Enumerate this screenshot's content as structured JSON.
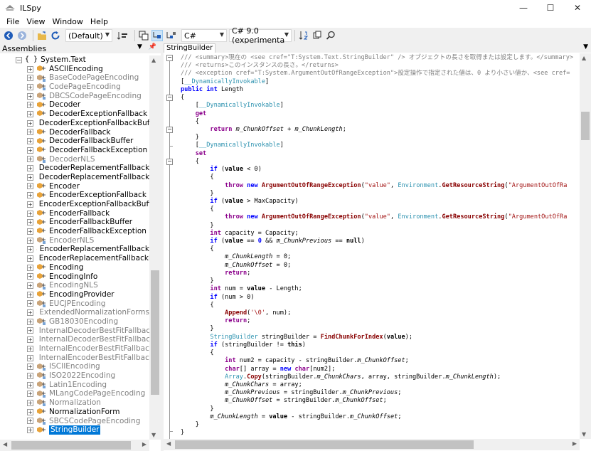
{
  "window": {
    "title": "ILSpy",
    "minimize": "—",
    "maximize": "☐",
    "close": "✕"
  },
  "menu": [
    "File",
    "View",
    "Window",
    "Help"
  ],
  "toolbar": {
    "assembly_list": "(Default)",
    "language": "C#",
    "language_version": "C# 9.0 (experimenta"
  },
  "assemblies_pane": {
    "title": "Assemblies",
    "namespace": "System.Text",
    "items": [
      {
        "label": "ASCIIEncoding",
        "public": true
      },
      {
        "label": "BaseCodePageEncoding",
        "public": false
      },
      {
        "label": "CodePageEncoding",
        "public": false
      },
      {
        "label": "DBCSCodePageEncoding",
        "public": false
      },
      {
        "label": "Decoder",
        "public": true
      },
      {
        "label": "DecoderExceptionFallback",
        "public": true
      },
      {
        "label": "DecoderExceptionFallbackBuffer",
        "public": true
      },
      {
        "label": "DecoderFallback",
        "public": true
      },
      {
        "label": "DecoderFallbackBuffer",
        "public": true
      },
      {
        "label": "DecoderFallbackException",
        "public": true
      },
      {
        "label": "DecoderNLS",
        "public": false
      },
      {
        "label": "DecoderReplacementFallback",
        "public": true
      },
      {
        "label": "DecoderReplacementFallbackBuffer",
        "public": true
      },
      {
        "label": "Encoder",
        "public": true
      },
      {
        "label": "EncoderExceptionFallback",
        "public": true
      },
      {
        "label": "EncoderExceptionFallbackBuffer",
        "public": true
      },
      {
        "label": "EncoderFallback",
        "public": true
      },
      {
        "label": "EncoderFallbackBuffer",
        "public": true
      },
      {
        "label": "EncoderFallbackException",
        "public": true
      },
      {
        "label": "EncoderNLS",
        "public": false
      },
      {
        "label": "EncoderReplacementFallback",
        "public": true
      },
      {
        "label": "EncoderReplacementFallbackBuffer",
        "public": true
      },
      {
        "label": "Encoding",
        "public": true
      },
      {
        "label": "EncodingInfo",
        "public": true
      },
      {
        "label": "EncodingNLS",
        "public": false
      },
      {
        "label": "EncodingProvider",
        "public": true
      },
      {
        "label": "EUCJPEncoding",
        "public": false
      },
      {
        "label": "ExtendedNormalizationForms",
        "public": false
      },
      {
        "label": "GB18030Encoding",
        "public": false
      },
      {
        "label": "InternalDecoderBestFitFallback",
        "public": false
      },
      {
        "label": "InternalDecoderBestFitFallbackBuffer",
        "public": false
      },
      {
        "label": "InternalEncoderBestFitFallback",
        "public": false
      },
      {
        "label": "InternalEncoderBestFitFallbackBuffer",
        "public": false
      },
      {
        "label": "ISCIIEncoding",
        "public": false
      },
      {
        "label": "ISO2022Encoding",
        "public": false
      },
      {
        "label": "Latin1Encoding",
        "public": false
      },
      {
        "label": "MLangCodePageEncoding",
        "public": false
      },
      {
        "label": "Normalization",
        "public": false
      },
      {
        "label": "NormalizationForm",
        "public": true
      },
      {
        "label": "SBCSCodePageEncoding",
        "public": false
      },
      {
        "label": "StringBuilder",
        "public": true,
        "selected": true
      }
    ]
  },
  "tab": {
    "label": "StringBuilder"
  },
  "code_lines": [
    [
      {
        "c": "cm",
        "t": "/// <summary>"
      },
      {
        "c": "cm",
        "t": "現在の "
      },
      {
        "c": "cm",
        "t": "<see cref=\"T:System.Text.StringBuilder\" />"
      },
      {
        "c": "cm",
        "t": " オブジェクトの長さを取得または設定します。</summary>"
      }
    ],
    [
      {
        "c": "cm",
        "t": "/// <returns>"
      },
      {
        "c": "cm",
        "t": "このインスタンスの長さ。</returns>"
      }
    ],
    [
      {
        "c": "cm",
        "t": "/// <exception cref=\"T:System.ArgumentOutOfRangeException\">"
      },
      {
        "c": "cm",
        "t": "設定操作で指定された値は、0 より小さい値か、<see cref="
      }
    ],
    [
      {
        "c": "",
        "t": "["
      },
      {
        "c": "at",
        "t": "__DynamicallyInvokable"
      },
      {
        "c": "",
        "t": "]"
      }
    ],
    [
      {
        "c": "kb",
        "t": "public"
      },
      {
        "c": "",
        "t": " "
      },
      {
        "c": "kb",
        "t": "int"
      },
      {
        "c": "",
        "t": " Length"
      }
    ],
    [
      {
        "c": "",
        "t": "{"
      }
    ],
    [
      {
        "c": "",
        "t": "    ["
      },
      {
        "c": "at",
        "t": "__DynamicallyInvokable"
      },
      {
        "c": "",
        "t": "]"
      }
    ],
    [
      {
        "c": "",
        "t": "    "
      },
      {
        "c": "kd",
        "t": "get"
      }
    ],
    [
      {
        "c": "",
        "t": "    {"
      }
    ],
    [
      {
        "c": "",
        "t": "        "
      },
      {
        "c": "kd",
        "t": "return"
      },
      {
        "c": "",
        "t": " "
      },
      {
        "c": "f",
        "t": "m_ChunkOffset"
      },
      {
        "c": "",
        "t": " + "
      },
      {
        "c": "f",
        "t": "m_ChunkLength"
      },
      {
        "c": "",
        "t": ";"
      }
    ],
    [
      {
        "c": "",
        "t": "    }"
      }
    ],
    [
      {
        "c": "",
        "t": "    ["
      },
      {
        "c": "at",
        "t": "__DynamicallyInvokable"
      },
      {
        "c": "",
        "t": "]"
      }
    ],
    [
      {
        "c": "",
        "t": "    "
      },
      {
        "c": "kd",
        "t": "set"
      }
    ],
    [
      {
        "c": "",
        "t": "    {"
      }
    ],
    [
      {
        "c": "",
        "t": "        "
      },
      {
        "c": "kb",
        "t": "if"
      },
      {
        "c": "",
        "t": " ("
      },
      {
        "c": "n",
        "t": "value"
      },
      {
        "c": "",
        "t": " < 0)"
      }
    ],
    [
      {
        "c": "",
        "t": "        {"
      }
    ],
    [
      {
        "c": "",
        "t": "            "
      },
      {
        "c": "kd",
        "t": "throw"
      },
      {
        "c": "",
        "t": " "
      },
      {
        "c": "kb",
        "t": "new"
      },
      {
        "c": "",
        "t": " "
      },
      {
        "c": "m",
        "t": "ArgumentOutOfRangeException"
      },
      {
        "c": "",
        "t": "("
      },
      {
        "c": "s",
        "t": "\"value\""
      },
      {
        "c": "",
        "t": ", "
      },
      {
        "c": "t",
        "t": "Environment"
      },
      {
        "c": "",
        "t": "."
      },
      {
        "c": "m",
        "t": "GetResourceString"
      },
      {
        "c": "",
        "t": "("
      },
      {
        "c": "s",
        "t": "\"ArgumentOutOfRa"
      }
    ],
    [
      {
        "c": "",
        "t": "        }"
      }
    ],
    [
      {
        "c": "",
        "t": "        "
      },
      {
        "c": "kb",
        "t": "if"
      },
      {
        "c": "",
        "t": " ("
      },
      {
        "c": "n",
        "t": "value"
      },
      {
        "c": "",
        "t": " > MaxCapacity)"
      }
    ],
    [
      {
        "c": "",
        "t": "        {"
      }
    ],
    [
      {
        "c": "",
        "t": "            "
      },
      {
        "c": "kd",
        "t": "throw"
      },
      {
        "c": "",
        "t": " "
      },
      {
        "c": "kb",
        "t": "new"
      },
      {
        "c": "",
        "t": " "
      },
      {
        "c": "m",
        "t": "ArgumentOutOfRangeException"
      },
      {
        "c": "",
        "t": "("
      },
      {
        "c": "s",
        "t": "\"value\""
      },
      {
        "c": "",
        "t": ", "
      },
      {
        "c": "t",
        "t": "Environment"
      },
      {
        "c": "",
        "t": "."
      },
      {
        "c": "m",
        "t": "GetResourceString"
      },
      {
        "c": "",
        "t": "("
      },
      {
        "c": "s",
        "t": "\"ArgumentOutOfRa"
      }
    ],
    [
      {
        "c": "",
        "t": "        }"
      }
    ],
    [
      {
        "c": "",
        "t": "        "
      },
      {
        "c": "kd",
        "t": "int"
      },
      {
        "c": "",
        "t": " capacity = Capacity;"
      }
    ],
    [
      {
        "c": "",
        "t": "        "
      },
      {
        "c": "kb",
        "t": "if"
      },
      {
        "c": "",
        "t": " ("
      },
      {
        "c": "n",
        "t": "value"
      },
      {
        "c": "",
        "t": " == "
      },
      {
        "c": "kb",
        "t": "0"
      },
      {
        "c": "",
        "t": " && "
      },
      {
        "c": "f",
        "t": "m_ChunkPrevious"
      },
      {
        "c": "",
        "t": " == "
      },
      {
        "c": "n",
        "t": "null"
      },
      {
        "c": "",
        "t": ")"
      }
    ],
    [
      {
        "c": "",
        "t": "        {"
      }
    ],
    [
      {
        "c": "",
        "t": "            "
      },
      {
        "c": "f",
        "t": "m_ChunkLength"
      },
      {
        "c": "",
        "t": " = 0;"
      }
    ],
    [
      {
        "c": "",
        "t": "            "
      },
      {
        "c": "f",
        "t": "m_ChunkOffset"
      },
      {
        "c": "",
        "t": " = 0;"
      }
    ],
    [
      {
        "c": "",
        "t": "            "
      },
      {
        "c": "kd",
        "t": "return"
      },
      {
        "c": "",
        "t": ";"
      }
    ],
    [
      {
        "c": "",
        "t": "        }"
      }
    ],
    [
      {
        "c": "",
        "t": "        "
      },
      {
        "c": "kd",
        "t": "int"
      },
      {
        "c": "",
        "t": " num = "
      },
      {
        "c": "n",
        "t": "value"
      },
      {
        "c": "",
        "t": " - Length;"
      }
    ],
    [
      {
        "c": "",
        "t": "        "
      },
      {
        "c": "kb",
        "t": "if"
      },
      {
        "c": "",
        "t": " (num > 0)"
      }
    ],
    [
      {
        "c": "",
        "t": "        {"
      }
    ],
    [
      {
        "c": "",
        "t": "            "
      },
      {
        "c": "m",
        "t": "Append"
      },
      {
        "c": "",
        "t": "("
      },
      {
        "c": "s",
        "t": "'\\0'"
      },
      {
        "c": "",
        "t": ", num);"
      }
    ],
    [
      {
        "c": "",
        "t": "            "
      },
      {
        "c": "kd",
        "t": "return"
      },
      {
        "c": "",
        "t": ";"
      }
    ],
    [
      {
        "c": "",
        "t": "        }"
      }
    ],
    [
      {
        "c": "",
        "t": "        "
      },
      {
        "c": "t",
        "t": "StringBuilder"
      },
      {
        "c": "",
        "t": " stringBuilder = "
      },
      {
        "c": "m",
        "t": "FindChunkForIndex"
      },
      {
        "c": "",
        "t": "("
      },
      {
        "c": "n",
        "t": "value"
      },
      {
        "c": "",
        "t": ");"
      }
    ],
    [
      {
        "c": "",
        "t": "        "
      },
      {
        "c": "kb",
        "t": "if"
      },
      {
        "c": "",
        "t": " (stringBuilder != "
      },
      {
        "c": "n",
        "t": "this"
      },
      {
        "c": "",
        "t": ")"
      }
    ],
    [
      {
        "c": "",
        "t": "        {"
      }
    ],
    [
      {
        "c": "",
        "t": "            "
      },
      {
        "c": "kd",
        "t": "int"
      },
      {
        "c": "",
        "t": " num2 = capacity - stringBuilder."
      },
      {
        "c": "f",
        "t": "m_ChunkOffset"
      },
      {
        "c": "",
        "t": ";"
      }
    ],
    [
      {
        "c": "",
        "t": "            "
      },
      {
        "c": "kd",
        "t": "char"
      },
      {
        "c": "",
        "t": "[] array = "
      },
      {
        "c": "kb",
        "t": "new"
      },
      {
        "c": "",
        "t": " "
      },
      {
        "c": "kd",
        "t": "char"
      },
      {
        "c": "",
        "t": "[num2];"
      }
    ],
    [
      {
        "c": "",
        "t": "            "
      },
      {
        "c": "t",
        "t": "Array"
      },
      {
        "c": "",
        "t": "."
      },
      {
        "c": "m",
        "t": "Copy"
      },
      {
        "c": "",
        "t": "(stringBuilder."
      },
      {
        "c": "f",
        "t": "m_ChunkChars"
      },
      {
        "c": "",
        "t": ", array, stringBuilder."
      },
      {
        "c": "f",
        "t": "m_ChunkLength"
      },
      {
        "c": "",
        "t": ");"
      }
    ],
    [
      {
        "c": "",
        "t": "            "
      },
      {
        "c": "f",
        "t": "m_ChunkChars"
      },
      {
        "c": "",
        "t": " = array;"
      }
    ],
    [
      {
        "c": "",
        "t": "            "
      },
      {
        "c": "f",
        "t": "m_ChunkPrevious"
      },
      {
        "c": "",
        "t": " = stringBuilder."
      },
      {
        "c": "f",
        "t": "m_ChunkPrevious"
      },
      {
        "c": "",
        "t": ";"
      }
    ],
    [
      {
        "c": "",
        "t": "            "
      },
      {
        "c": "f",
        "t": "m_ChunkOffset"
      },
      {
        "c": "",
        "t": " = stringBuilder."
      },
      {
        "c": "f",
        "t": "m_ChunkOffset"
      },
      {
        "c": "",
        "t": ";"
      }
    ],
    [
      {
        "c": "",
        "t": "        }"
      }
    ],
    [
      {
        "c": "",
        "t": "        "
      },
      {
        "c": "f",
        "t": "m_ChunkLength"
      },
      {
        "c": "",
        "t": " = "
      },
      {
        "c": "n",
        "t": "value"
      },
      {
        "c": "",
        "t": " - stringBuilder."
      },
      {
        "c": "f",
        "t": "m_ChunkOffset"
      },
      {
        "c": "",
        "t": ";"
      }
    ],
    [
      {
        "c": "",
        "t": "    }"
      }
    ],
    [
      {
        "c": "",
        "t": "}"
      }
    ]
  ]
}
